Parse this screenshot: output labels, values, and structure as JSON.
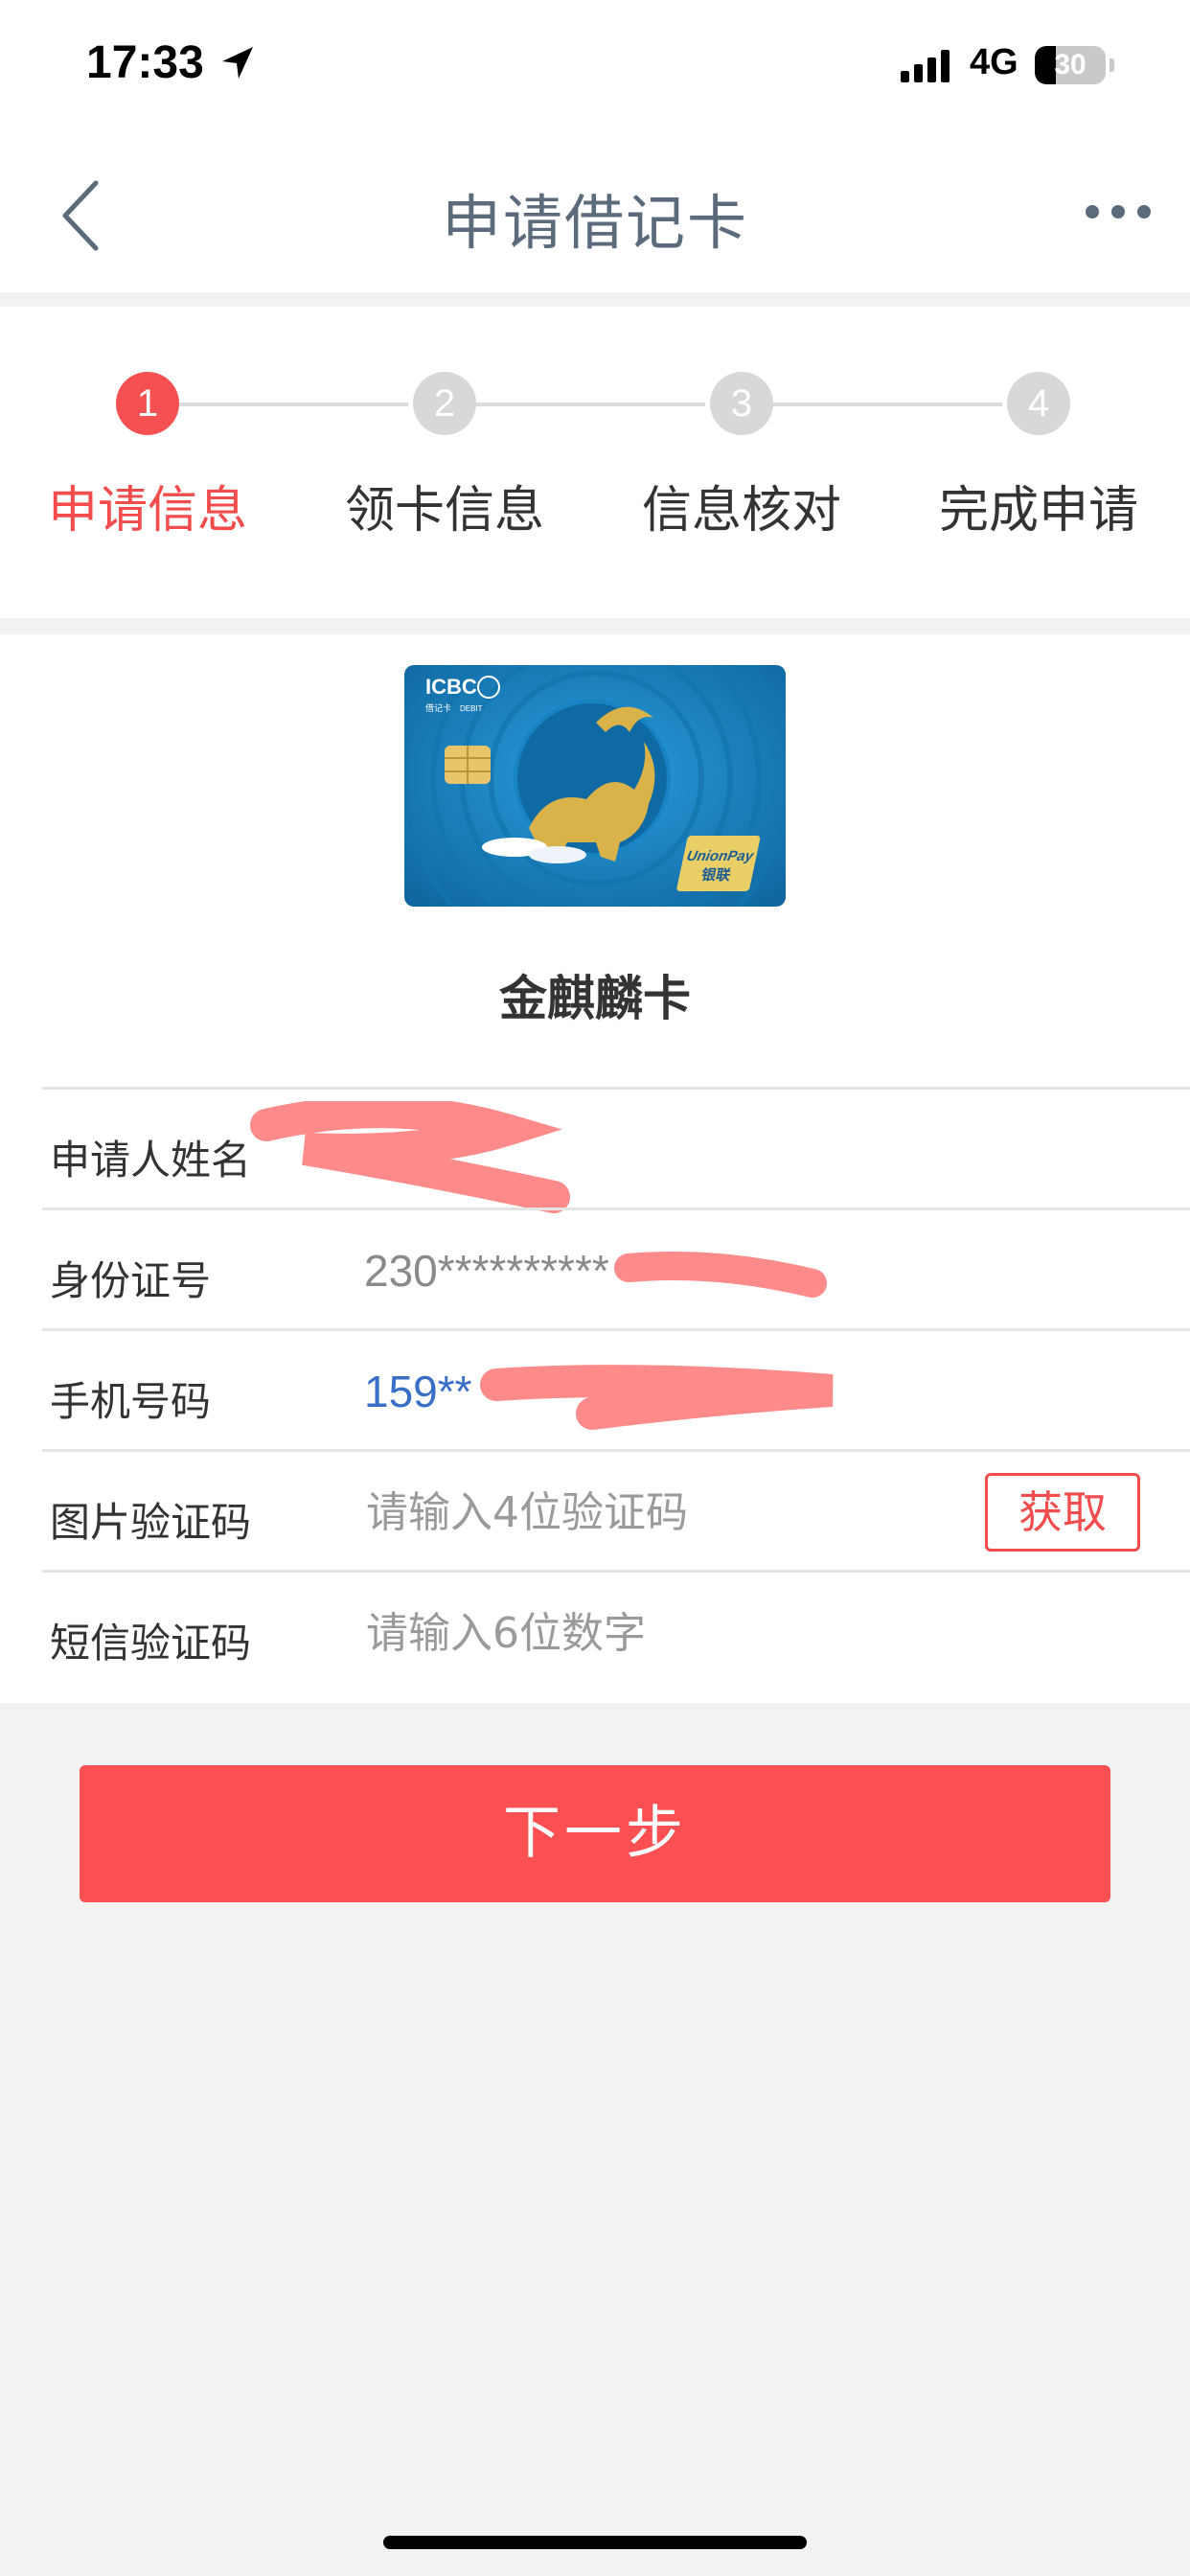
{
  "status_bar": {
    "time": "17:33",
    "network": "4G",
    "battery": "30",
    "battery_level": 0.3
  },
  "nav": {
    "title": "申请借记卡"
  },
  "steps": [
    {
      "number": "1",
      "label": "申请信息",
      "active": true
    },
    {
      "number": "2",
      "label": "领卡信息",
      "active": false
    },
    {
      "number": "3",
      "label": "信息核对",
      "active": false
    },
    {
      "number": "4",
      "label": "完成申请",
      "active": false
    }
  ],
  "card": {
    "name": "金麒麟卡",
    "brand": "ICBC",
    "card_type_cn": "借记卡",
    "card_type_en": "DEBIT",
    "network_en": "UnionPay",
    "network_cn": "银联"
  },
  "form": {
    "applicant_name": {
      "label": "申请人姓名",
      "value": ""
    },
    "id_number": {
      "label": "身份证号",
      "value": "230**********"
    },
    "phone": {
      "label": "手机号码",
      "value": "159**"
    },
    "captcha": {
      "label": "图片验证码",
      "placeholder": "请输入4位验证码",
      "button": "获取"
    },
    "sms_code": {
      "label": "短信验证码",
      "placeholder": "请输入6位数字"
    }
  },
  "next_button": "下一步",
  "colors": {
    "accent_red": "#f24c4d",
    "button_red": "#fd5052",
    "title_gray": "#5b6b7c",
    "card_blue": "#1a8ac7",
    "card_gold": "#d9b24a"
  }
}
